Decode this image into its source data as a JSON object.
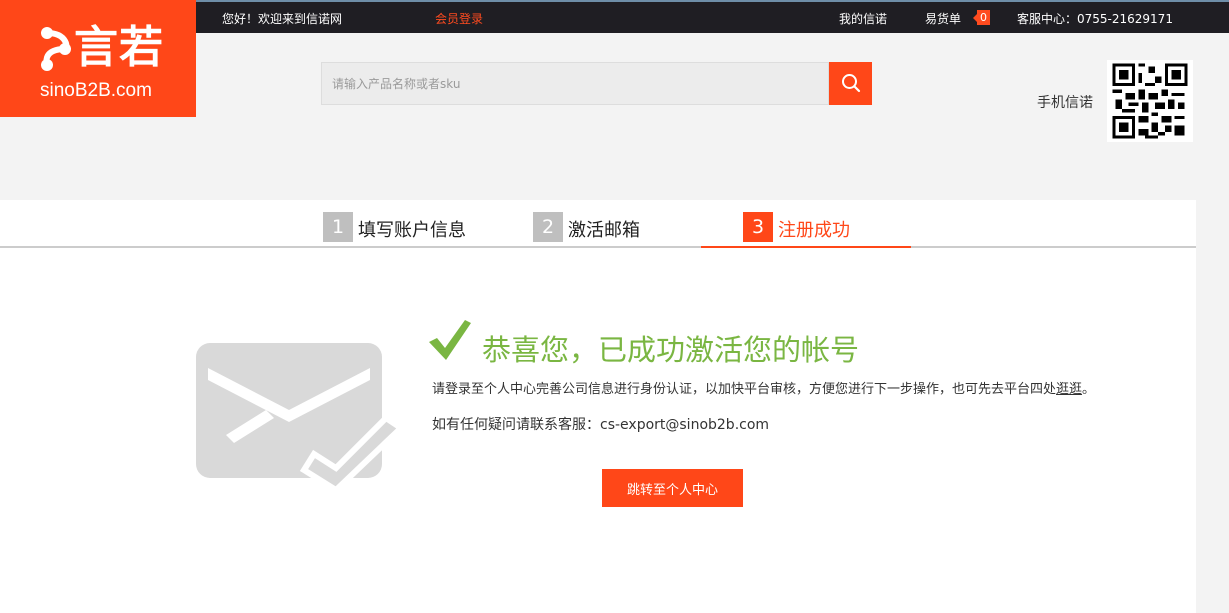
{
  "topbar": {
    "welcome": "您好！欢迎来到信诺网",
    "member_login": "会员登录",
    "my_sinuo": "我的信诺",
    "cart_label": "易货单",
    "cart_count": "0",
    "service": "客服中心：0755-21629171"
  },
  "logo": {
    "chars": "言若",
    "domain": "sinoB2B.com"
  },
  "search": {
    "placeholder": "请输入产品名称或者sku",
    "button_icon": "search-icon"
  },
  "mobile": {
    "label": "手机信诺",
    "icon": "qr-code-icon"
  },
  "steps": [
    {
      "num": "1",
      "label": "填写账户信息",
      "active": false
    },
    {
      "num": "2",
      "label": "激活邮箱",
      "active": false
    },
    {
      "num": "3",
      "label": "注册成功",
      "active": true
    }
  ],
  "success": {
    "title": "恭喜您，已成功激活您的帐号",
    "desc_text": "请登录至个人中心完善公司信息进行身份认证，以加快平台审核，方便您进行下一步操作，也可先去平台四处",
    "desc_link": "逛逛",
    "desc_end": "。",
    "contact_prefix": "如有任何疑问请联系客服：",
    "contact_email": "cs-export@sinob2b.com",
    "button": "跳转至个人中心"
  },
  "colors": {
    "brand": "#ff4718",
    "success": "#7ab642",
    "topbar": "#1f1e23"
  }
}
